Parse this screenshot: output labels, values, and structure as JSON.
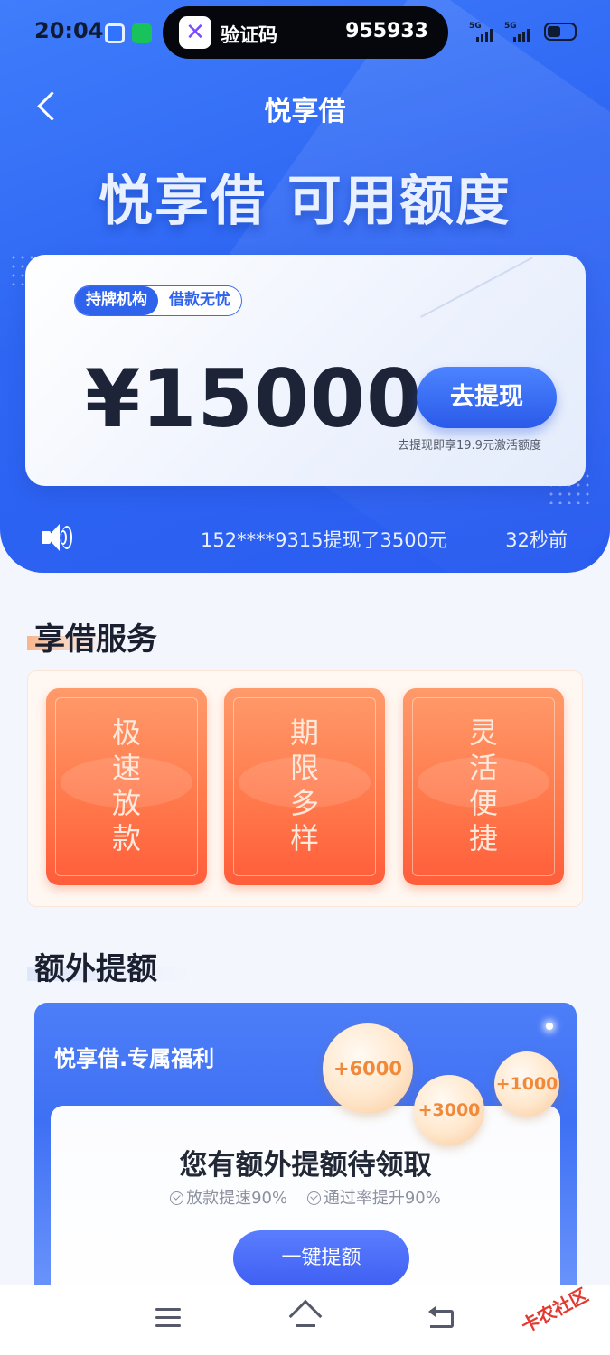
{
  "status_bar": {
    "time": "20:04",
    "notification_title": "验证码",
    "notification_code": "955933",
    "network_1": "5G",
    "network_2": "5G"
  },
  "header": {
    "nav_title": "悦享借",
    "hero_title": "悦享借 可用额度"
  },
  "credit_card": {
    "badge_left": "持牌机构",
    "badge_right": "借款无忧",
    "amount": "¥15000",
    "withdraw_label": "去提现",
    "withdraw_note": "去提现即享19.9元激活额度"
  },
  "ticker": {
    "message": "152****9315提现了3500元",
    "time": "32秒前"
  },
  "services": {
    "title": "享借服务",
    "items": [
      {
        "chars": [
          "极",
          "速",
          "放",
          "款"
        ]
      },
      {
        "chars": [
          "期",
          "限",
          "多",
          "样"
        ]
      },
      {
        "chars": [
          "灵",
          "活",
          "便",
          "捷"
        ]
      }
    ]
  },
  "extra": {
    "title": "额外提额",
    "promo_title": "悦享借.专属福利",
    "bubbles": [
      "+6000",
      "+3000",
      "+1000"
    ],
    "headline": "您有额外提额待领取",
    "perk_1": "放款提速90%",
    "perk_2": "通过率提升90%",
    "button_label": "一键提额"
  },
  "watermark": "卡农社区",
  "colors": {
    "primary_blue": "#2e66f3",
    "service_orange": "#ff7a4d",
    "bubble_text": "#f08a3a"
  }
}
